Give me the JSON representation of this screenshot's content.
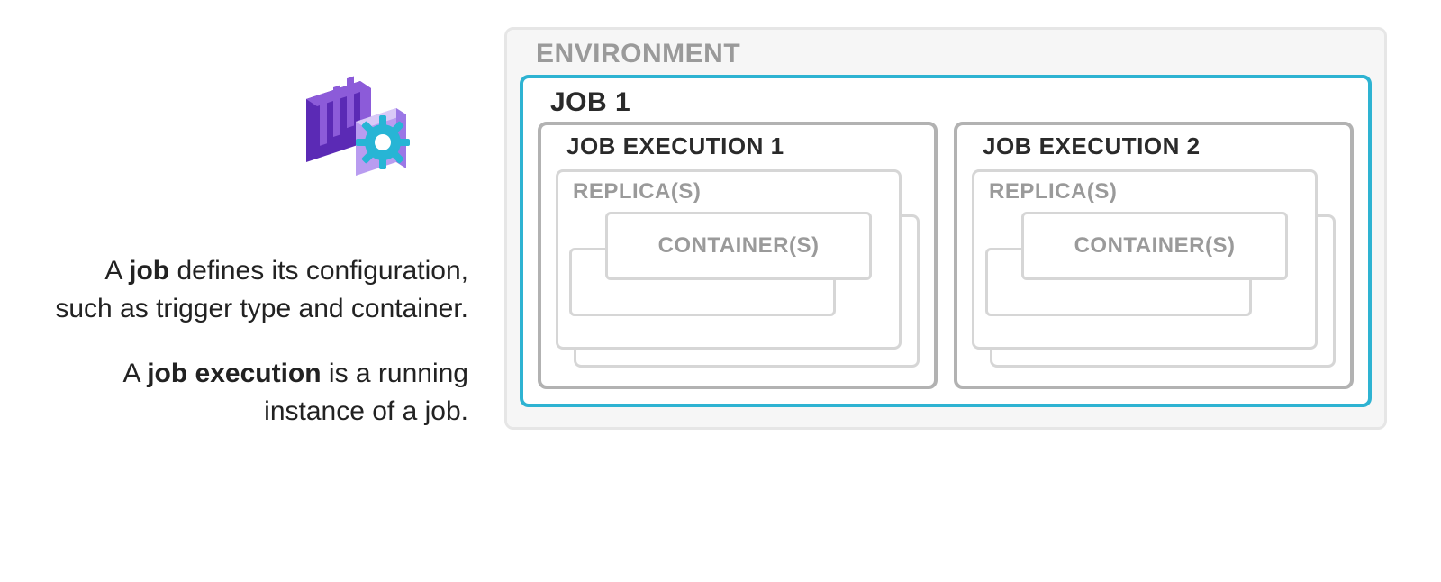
{
  "icon_name": "container-app-job-icon",
  "description": {
    "p1_pre": "A ",
    "p1_b": "job",
    "p1_post": " defines its configuration, such as trigger type and container.",
    "p2_pre": "A ",
    "p2_b": "job execution",
    "p2_post": " is a running instance of a job."
  },
  "diagram": {
    "environment_label": "ENVIRONMENT",
    "job_label": "JOB 1",
    "executions": [
      {
        "label": "JOB EXECUTION 1",
        "replica_label": "REPLICA(S)",
        "container_label": "CONTAINER(S)"
      },
      {
        "label": "JOB EXECUTION 2",
        "replica_label": "REPLICA(S)",
        "container_label": "CONTAINER(S)"
      }
    ]
  },
  "colors": {
    "accent_blue": "#2eb3d2",
    "icon_purple_dark": "#5b2ab5",
    "icon_purple_mid": "#8c5bd9",
    "icon_purple_light": "#b99cf0",
    "icon_gear": "#27b5d5"
  }
}
